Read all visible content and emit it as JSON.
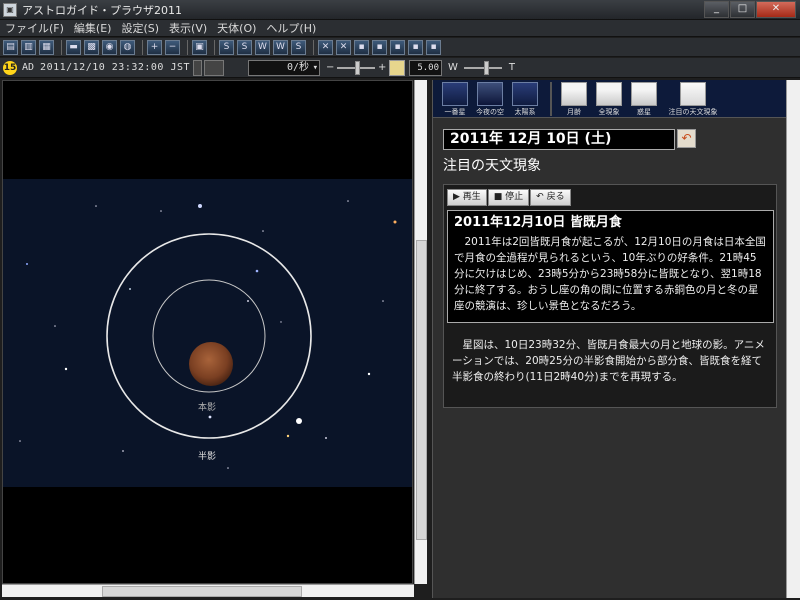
{
  "window": {
    "title": "アストロガイド・プラウザ2011",
    "controls": {
      "minimize": "_",
      "maximize": "□",
      "close": "✕"
    }
  },
  "menu": [
    "ファイル(F)",
    "編集(E)",
    "設定(S)",
    "表示(V)",
    "天体(O)",
    "ヘルプ(H)"
  ],
  "toolbar2": {
    "day_badge": "15",
    "era": "AD",
    "datetime": "2011/12/10 23:32:00 JST",
    "rate": "0/秒",
    "mag": "5.00",
    "w_label": "W",
    "t_label": "T",
    "fov_minus": "−",
    "fov_plus": "+",
    "fov_level": 0.55,
    "wt_level": 0.6
  },
  "map": {
    "label_umbra": "本影",
    "label_penumbra": "半影",
    "colors": {
      "sky": "#0a1428",
      "moon": "#8a4a2a",
      "circle": "#e8e8e8"
    }
  },
  "quick_bar": [
    {
      "label": "一番星",
      "icon": "first-star-icon",
      "style": ""
    },
    {
      "label": "今夜の空",
      "icon": "tonight-sky-icon",
      "style": "night"
    },
    {
      "label": "太陽系",
      "icon": "solar-system-icon",
      "style": ""
    },
    {
      "label": "月齢",
      "icon": "moon-age-icon",
      "style": "cal"
    },
    {
      "label": "全現象",
      "icon": "all-events-icon",
      "style": "cal"
    },
    {
      "label": "惑星",
      "icon": "planets-icon",
      "style": "cal"
    },
    {
      "label": "注目の天文現象",
      "icon": "featured-events-icon",
      "style": "alert"
    }
  ],
  "date_box": "2011年 12月 10日 (土)",
  "back_icon": "↶",
  "section_title": "注目の天文現象",
  "controls": {
    "play": "▶ 再生",
    "stop": "■ 停止",
    "back": "↶ 戻る"
  },
  "event": {
    "title": "2011年12月10日 皆既月食",
    "description": "2011年は2回皆既月食が起こるが、12月10日の月食は日本全国で月食の全過程が見られるという、10年ぶりの好条件。21時45分に欠けはじめ、23時5分から23時58分に皆既となり、翌1時18分に終了する。おうし座の角の間に位置する赤銅色の月と冬の星座の競演は、珍しい景色となるだろう。"
  },
  "note": "星図は、10日23時32分、皆既月食最大の月と地球の影。アニメーションでは、20時25分の半影食開始から部分食、皆既食を経て半影食の終わり(11日2時40分)までを再現する。"
}
